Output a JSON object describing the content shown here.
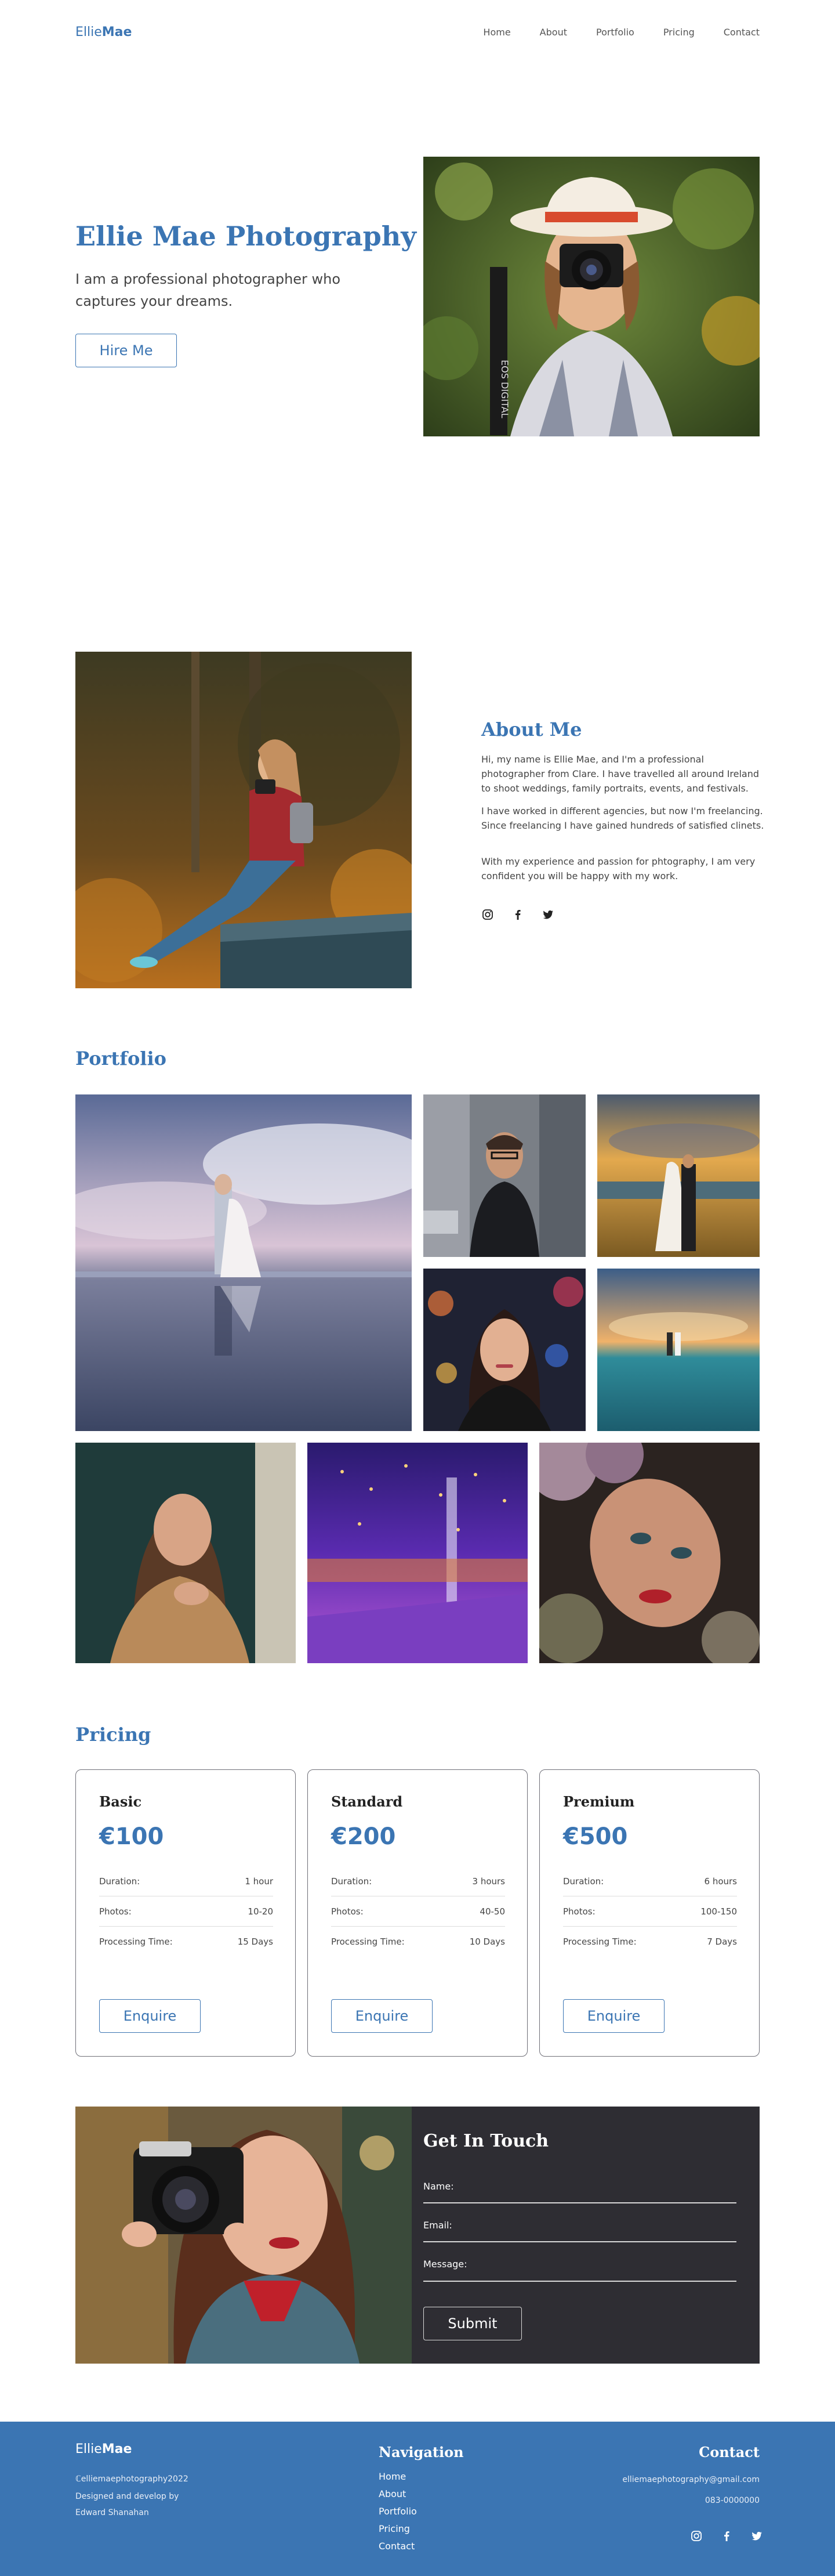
{
  "header": {
    "logo_light": "Ellie",
    "logo_bold": "Mae",
    "nav": [
      "Home",
      "About",
      "Portfolio",
      "Pricing",
      "Contact"
    ]
  },
  "hero": {
    "title": "Ellie Mae Photography",
    "subtitle": "I am a professional photographer who captures your dreams.",
    "button": "Hire Me"
  },
  "about": {
    "title": "About Me",
    "paragraphs": [
      "Hi, my name is Ellie Mae, and I'm a professional photographer from Clare. I have travelled all around Ireland to shoot weddings, family portraits, events, and festivals.",
      "I have worked in different agencies, but now I'm freelancing. Since freelancing I have gained hundreds of satisfied clinets.",
      "With my experience and passion for phtography, I am very confident you will be happy with my work."
    ],
    "social_icons": [
      "instagram-icon",
      "facebook-icon",
      "twitter-icon"
    ]
  },
  "portfolio": {
    "title": "Portfolio"
  },
  "pricing": {
    "title": "Pricing",
    "row_labels": [
      "Duration:",
      "Photos:",
      "Processing Time:"
    ],
    "button": "Enquire",
    "plans": [
      {
        "name": "Basic",
        "price": "€100",
        "duration": "1 hour",
        "photos": "10-20",
        "processing": "15 Days"
      },
      {
        "name": "Standard",
        "price": "€200",
        "duration": "3 hours",
        "photos": "40-50",
        "processing": "10 Days"
      },
      {
        "name": "Premium",
        "price": "€500",
        "duration": "6 hours",
        "photos": "100-150",
        "processing": "7 Days"
      }
    ]
  },
  "contact": {
    "title": "Get In Touch",
    "name_label": "Name:",
    "email_label": "Email:",
    "message_label": "Message:",
    "submit": "Submit"
  },
  "footer": {
    "logo_light": "Ellie",
    "logo_bold": "Mae",
    "copyright": "ℂelliemaephotography2022",
    "credit_line1": "Designed and develop by",
    "credit_line2": "Edward Shanahan",
    "nav_title": "Navigation",
    "nav": [
      "Home",
      "About",
      "Portfolio",
      "Pricing",
      "Contact"
    ],
    "contact_title": "Contact",
    "email": "elliemaephotography@gmail.com",
    "phone": "083-0000000"
  },
  "colors": {
    "accent": "#3b75b3",
    "dark_panel": "#2e2d33",
    "footer_bg": "#3b75b3"
  }
}
